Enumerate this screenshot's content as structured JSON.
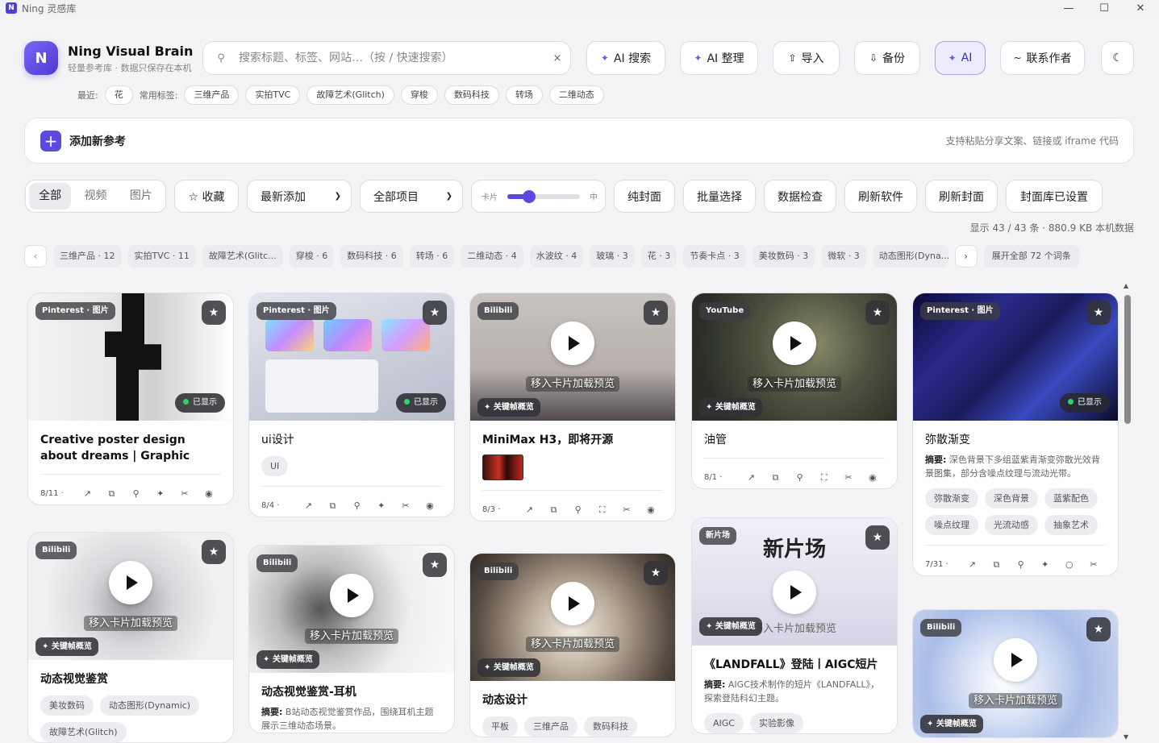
{
  "window": {
    "title": "Ning 灵感库",
    "icon": "N"
  },
  "brand": {
    "logo": "N",
    "name": "Ning Visual Brain",
    "subtitle": "轻量参考库 · 数据只保存在本机"
  },
  "search": {
    "placeholder": "搜索标题、标签、网站…（按 / 快速搜索）",
    "clear": "×"
  },
  "toolbar": {
    "ai_search": "AI 搜索",
    "ai_organize": "AI 整理",
    "import": "导入",
    "backup": "备份",
    "ai": "AI",
    "contact": "联系作者",
    "theme": "☾"
  },
  "recent": {
    "label": "最近:",
    "items": [
      "花"
    ],
    "common_label": "常用标签:",
    "common": [
      "三维产品",
      "实拍TVC",
      "故障艺术(Glitch)",
      "穿梭",
      "数码科技",
      "转场",
      "二维动态"
    ]
  },
  "add": {
    "label": "添加新参考",
    "hint": "支持粘贴分享文案、链接或 iframe 代码"
  },
  "filters": {
    "segments": [
      "全部",
      "视频",
      "图片"
    ],
    "active_segment": 0,
    "favorites": "☆ 收藏",
    "sort": "最新添加",
    "project": "全部项目",
    "size_left": "卡片",
    "size_right": "中",
    "size_level": 0.3,
    "cover_only": "纯封面",
    "batch": "批量选择",
    "data_check": "数据检查",
    "refresh_app": "刷新软件",
    "refresh_cover": "刷新封面",
    "cover_set": "封面库已设置"
  },
  "count": "显示 43 / 43 条 · 880.9 KB 本机数据",
  "tagbar": {
    "items": [
      "三维产品 · 12",
      "实拍TVC · 11",
      "故障艺术(Glitc...",
      "穿梭 · 6",
      "数码科技 · 6",
      "转场 · 6",
      "二维动态 · 4",
      "水波纹 · 4",
      "玻璃 · 3",
      "花 · 3",
      "节奏卡点 · 3",
      "美妆数码 · 3",
      "微软 · 3",
      "动态图形(Dyna..."
    ],
    "expand": "展开全部 72 个词条"
  },
  "labels": {
    "shown": "已显示",
    "hover": "移入卡片加载预览",
    "keyframes": "✦ 关键帧概览",
    "summary": "摘要:"
  },
  "cards": [
    {
      "source": "Pinterest · 图片",
      "title": "Creative poster design about dreams | Graphic design poste...",
      "date": "8/11"
    },
    {
      "source": "Pinterest · 图片",
      "title": "ui设计",
      "tags": [
        "UI"
      ],
      "date": "8/4"
    },
    {
      "source": "Bilibili",
      "title": "MiniMax H3，即将开源",
      "date": "8/3"
    },
    {
      "source": "YouTube",
      "title": "油管",
      "date": "8/1"
    },
    {
      "source": "Pinterest · 图片",
      "title": "弥散渐变",
      "summary": "深色背景下多组蓝紫青渐变弥散光效背景图集，部分含噪点纹理与流动光带。",
      "tags": [
        "弥散渐变",
        "深色背景",
        "蓝紫配色",
        "噪点纹理",
        "光流动感",
        "抽象艺术"
      ],
      "date": "7/31"
    },
    {
      "source": "Bilibili",
      "title": "动态视觉鉴赏",
      "tags": [
        "美妆数码",
        "动态图形(Dynamic)",
        "故障艺术(Glitch)"
      ]
    },
    {
      "source": "Bilibili",
      "title": "动态视觉鉴赏-耳机",
      "summary": "B站动态视觉鉴赏作品，围绕耳机主题展示三维动态场景。"
    },
    {
      "source": "Bilibili",
      "title": "动态设计",
      "tags": [
        "平板",
        "三维产品",
        "数码科技"
      ]
    },
    {
      "source": "新片场",
      "title": "《LANDFALL》登陆丨AIGC短片",
      "summary": "AIGC技术制作的短片《LANDFALL》，探索登陆科幻主题。",
      "tags": [
        "AIGC",
        "实验影像"
      ],
      "thumb_text": "新片场"
    },
    {
      "source": "Bilibili"
    }
  ],
  "colors": {
    "accent": "#5b49e0",
    "shown_dot": "#2fd36a"
  }
}
